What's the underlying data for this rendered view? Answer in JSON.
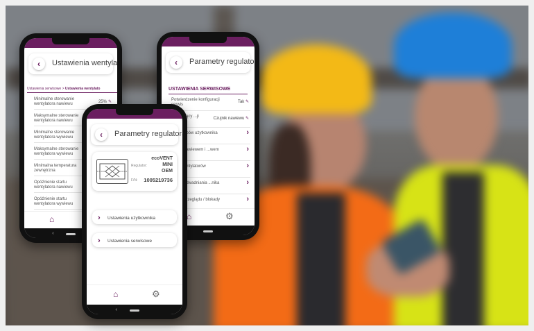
{
  "colors": {
    "brand": "#6b1f60",
    "helmet_yellow": "#f3b916",
    "helmet_blue": "#1e7fd8",
    "vest_orange": "#f36b16",
    "vest_yellow": "#d7e316"
  },
  "phone_left": {
    "title": "Ustawienia wentylatorów",
    "breadcrumb_part1": "Ustawienia serwisowe",
    "breadcrumb_sep": " > ",
    "breadcrumb_part2": "Ustawienia wentylato",
    "rows": [
      {
        "label": "Minimalne sterowanie wentylatora nawiewu",
        "value": "25%"
      },
      {
        "label": "Maksymalne sterowanie wentylatora nawiewu",
        "value": ""
      },
      {
        "label": "Minimalne sterowanie wentylatora wywiewu",
        "value": ""
      },
      {
        "label": "Maksymalne sterowanie wentylatora wywiewu",
        "value": ""
      },
      {
        "label": "Minimalna temperatura zewnętrzna",
        "value": ""
      },
      {
        "label": "Opóźnienie startu wentylatora nawiewu",
        "value": ""
      },
      {
        "label": "Opóźnienie startu wentylatora wywiewu",
        "value": ""
      }
    ],
    "icons": {
      "home": "home-icon"
    }
  },
  "phone_right": {
    "title": "Parametry regulatora",
    "section_title": "USTAWIENIA SERWISOWE",
    "rows": [
      {
        "label": "Potwierdzenie konfiguracji serwis",
        "value": "Tak",
        "type": "edit"
      },
      {
        "label": "...r wiodący ...ji",
        "value": "Czujnik nawiewu",
        "type": "edit"
      },
      {
        "label": "...nia trybów użytkownika",
        "value": "",
        "type": "nav"
      },
      {
        "label": "...anie nawiewem i ...wem",
        "value": "",
        "type": "nav"
      },
      {
        "label": "...nia wentylatorów",
        "value": "",
        "type": "nav"
      },
      {
        "label": "...enia odwadniania ...nika",
        "value": "",
        "type": "nav"
      },
      {
        "label": "...enia przeglądu / blokady",
        "value": "",
        "type": "nav"
      }
    ]
  },
  "phone_center": {
    "title": "Parametry regulatora",
    "device_name": "ecoVENT",
    "regulator_label": "Regulator:",
    "regulator_value_1": "MINI",
    "regulator_value_2": "OEM",
    "fn_label": "F/N:",
    "fn_value": "1005219736",
    "menu": [
      {
        "label": "Ustawienia użytkownika"
      },
      {
        "label": "Ustawienia serwisowe"
      }
    ]
  }
}
